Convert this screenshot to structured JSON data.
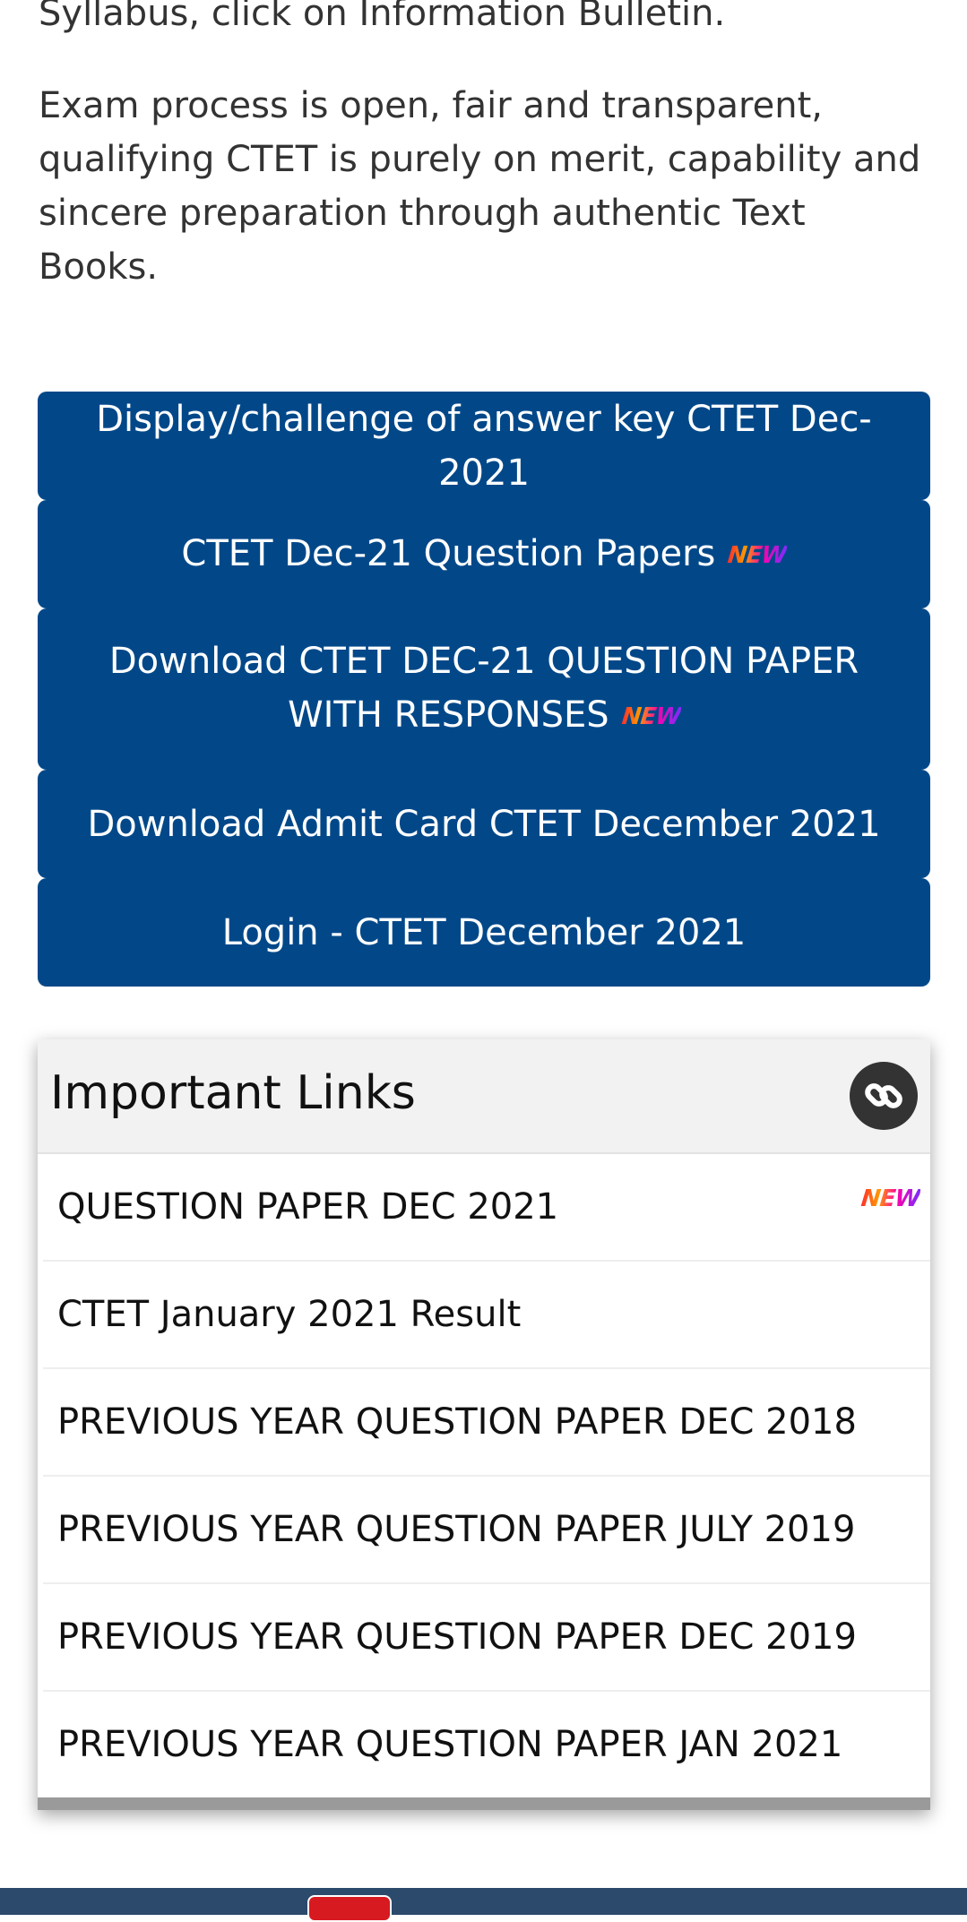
{
  "intro": {
    "line1": "Syllabus, click on Information Bulletin.",
    "line2": "Exam process is open, fair and transparent, qualifying CTET is purely on merit, capability and sincere preparation through authentic Text Books."
  },
  "buttons": [
    {
      "label": "Display/challenge of answer key CTET Dec-2021",
      "badge": ""
    },
    {
      "label": "CTET Dec-21 Question Papers",
      "badge": "NEW"
    },
    {
      "label": "Download CTET DEC-21 QUESTION PAPER WITH RESPONSES",
      "badge": "NEW"
    },
    {
      "label": "Download Admit Card CTET December 2021",
      "badge": ""
    },
    {
      "label": "Login - CTET December 2021",
      "badge": ""
    }
  ],
  "important_links": {
    "title": "Important Links",
    "icon": "link-icon",
    "items": [
      {
        "label": "QUESTION PAPER DEC 2021",
        "badge": "NEW"
      },
      {
        "label": "CTET January 2021 Result",
        "badge": ""
      },
      {
        "label": "PREVIOUS YEAR QUESTION PAPER DEC 2018",
        "badge": ""
      },
      {
        "label": "PREVIOUS YEAR QUESTION PAPER JULY 2019",
        "badge": ""
      },
      {
        "label": "PREVIOUS YEAR QUESTION PAPER DEC 2019",
        "badge": ""
      },
      {
        "label": "PREVIOUS YEAR QUESTION PAPER JAN 2021",
        "badge": ""
      }
    ]
  },
  "colors": {
    "button_bg": "#024889",
    "button_text": "#ffffff",
    "header_bg": "#f2f2f2",
    "footer_bg": "#2c4a6b"
  }
}
